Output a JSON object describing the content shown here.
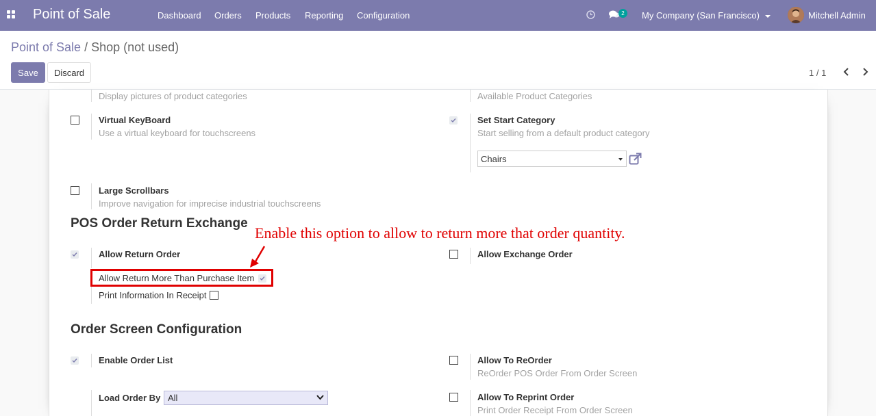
{
  "navbar": {
    "app_name": "Point of Sale",
    "menu": [
      "Dashboard",
      "Orders",
      "Products",
      "Reporting",
      "Configuration"
    ],
    "chat_count": "2",
    "company": "My Company (San Francisco)",
    "user": "Mitchell Admin",
    "bg_color": "#7c7bad"
  },
  "control": {
    "breadcrumb_root": "Point of Sale",
    "breadcrumb_sep": "/",
    "breadcrumb_current": "Shop (not used)",
    "save_label": "Save",
    "discard_label": "Discard",
    "pager": "1 / 1"
  },
  "form": {
    "partial_top_left_hint": "Display pictures of product categories",
    "partial_top_right_hint": "Available Product Categories",
    "virtual_keyboard": {
      "title": "Virtual KeyBoard",
      "hint": "Use a virtual keyboard for touchscreens",
      "checked": false
    },
    "start_category": {
      "title": "Set Start Category",
      "hint": "Start selling from a default product category",
      "checked": true,
      "value": "Chairs"
    },
    "large_scrollbars": {
      "title": "Large Scrollbars",
      "hint": "Improve navigation for imprecise industrial touchscreens",
      "checked": false
    },
    "section_return": "POS Order Return Exchange",
    "annotation": "Enable this option to allow to return more that order quantity.",
    "allow_return": {
      "title": "Allow Return Order",
      "checked": true
    },
    "allow_return_more": {
      "label": "Allow Return More Than Purchase Item",
      "checked": true
    },
    "print_info": {
      "label": "Print Information In Receipt",
      "checked": false
    },
    "allow_exchange": {
      "title": "Allow Exchange Order",
      "checked": false
    },
    "section_order_screen": "Order Screen Configuration",
    "enable_order_list": {
      "title": "Enable Order List",
      "checked": true
    },
    "load_order_by": {
      "label": "Load Order By",
      "value": "All"
    },
    "allow_reorder": {
      "title": "Allow To ReOrder",
      "hint": "ReOrder POS Order From Order Screen",
      "checked": false
    },
    "allow_reprint": {
      "title": "Allow To Reprint Order",
      "hint": "Print Order Receipt From Order Screen",
      "checked": false
    }
  },
  "colors": {
    "accent": "#7c7bad",
    "annotation": "#e00000"
  }
}
